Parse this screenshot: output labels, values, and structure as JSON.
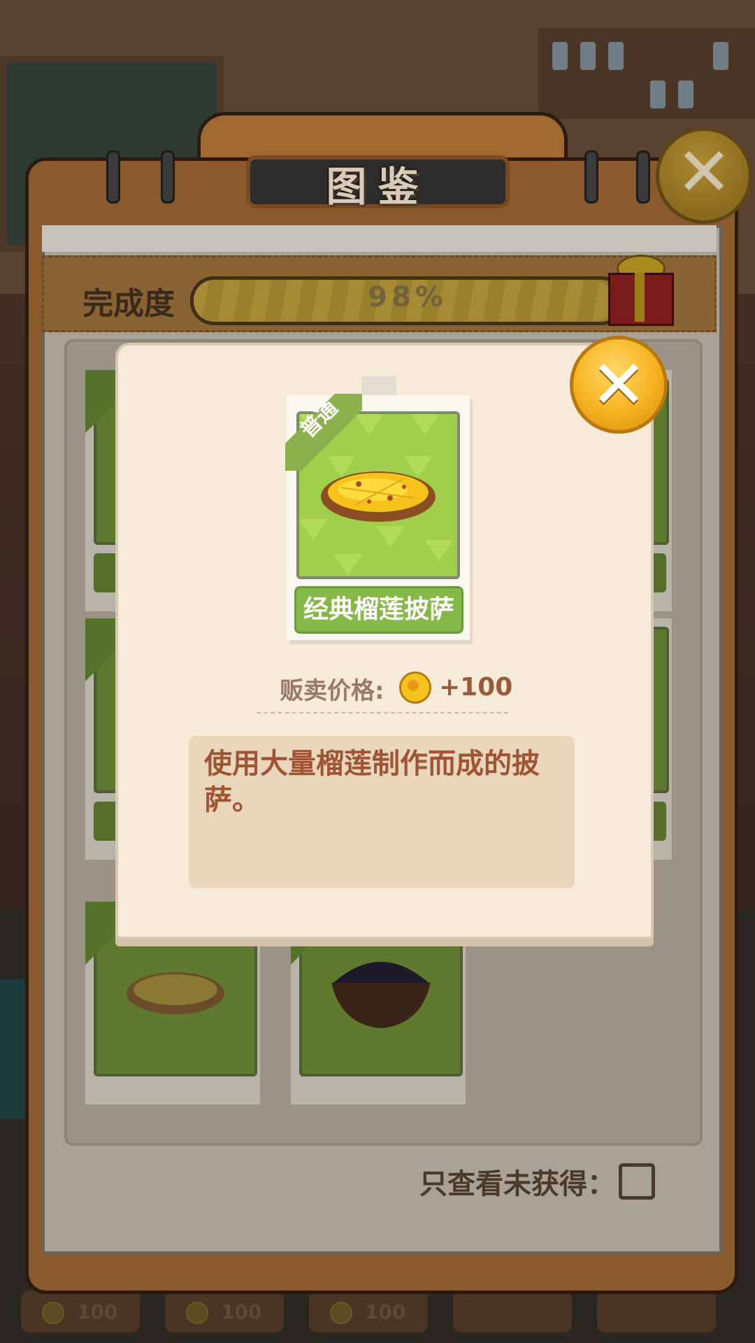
{
  "panel": {
    "title": "图鉴",
    "progress_label": "完成度",
    "progress_text": "98%",
    "progress_value": 0.98,
    "filter_label": "只查看未获得：",
    "filter_checked": false
  },
  "background": {
    "bottom_prices": [
      "100",
      "100",
      "100"
    ]
  },
  "detail": {
    "rarity": "普通",
    "food_name": "经典榴莲披萨",
    "price_label": "贩卖价格:",
    "price_value": "+100",
    "description": "使用大量榴莲制作而成的披萨。"
  },
  "icons": {
    "close": "close-icon",
    "coin": "coin-icon",
    "gift": "gift-icon",
    "pizza": "pizza-icon"
  },
  "colors": {
    "modal_bg": "#f6ead9",
    "close_gold": "#f5b21f",
    "label_green": "#85b847",
    "text_brown": "#9e5536"
  }
}
